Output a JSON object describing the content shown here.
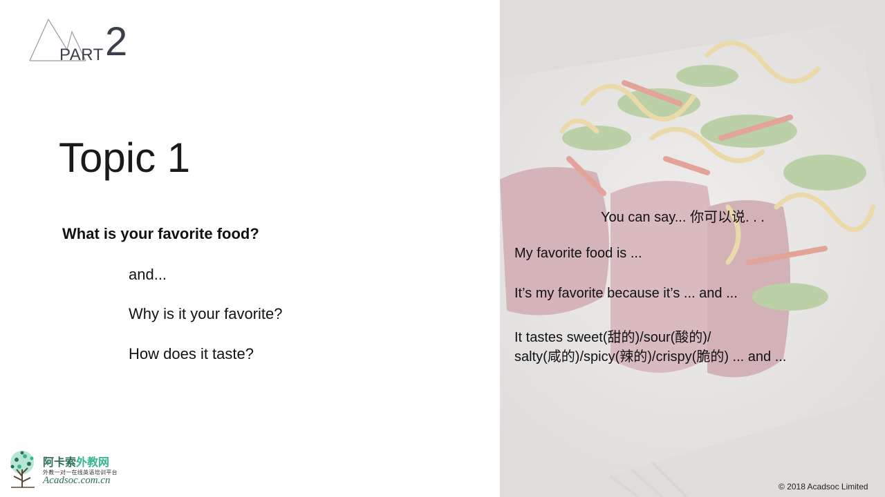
{
  "header": {
    "part_label": "PART",
    "part_number": "2"
  },
  "topic": {
    "title": "Topic 1"
  },
  "questions": {
    "main": "What is your favorite food?",
    "followups": [
      "and...",
      "Why is it your favorite?",
      "How does it taste?"
    ]
  },
  "phrases": {
    "heading": "You can say... 你可以说. . .",
    "lines": [
      "My favorite food is ...",
      "It’s my favorite because it’s ... and ...",
      "It tastes sweet(甜的)/sour(酸的)/",
      "salty(咸的)/spicy(辣的)/crispy(脆的) ... and ..."
    ]
  },
  "logo": {
    "name_cn_main": "阿卡索",
    "name_cn_accent": "外教网",
    "tagline": "外教一对一在线英语培训平台",
    "url": "Acadsoc.com.cn",
    "icon": "tree-icon"
  },
  "footer": {
    "copyright": "© 2018 Acadsoc Limited"
  },
  "colors": {
    "brand_green": "#2a6e55",
    "brand_accent": "#35b889",
    "heading_gray": "#3a3f4a"
  }
}
